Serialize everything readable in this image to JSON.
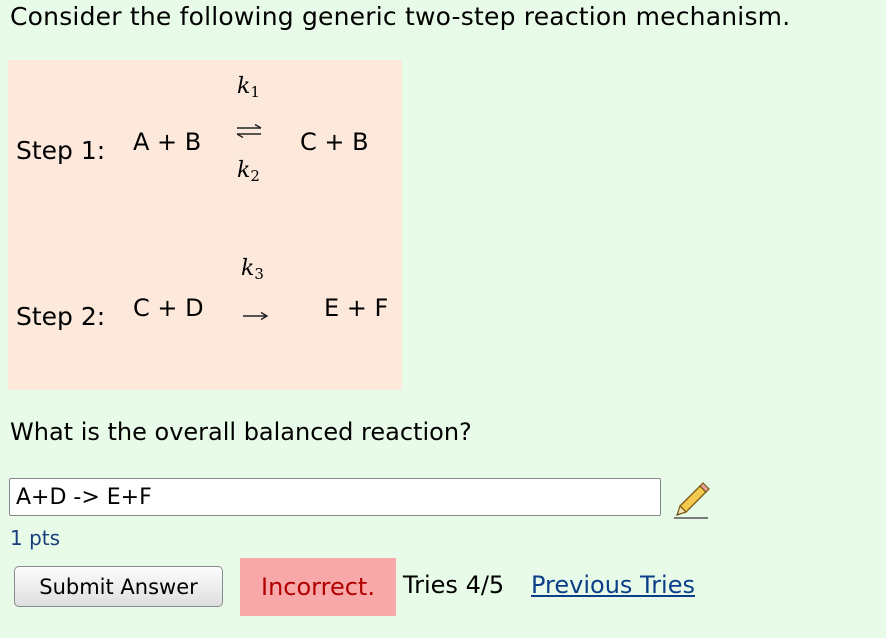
{
  "intro": "Consider the following generic two-step reaction mechanism.",
  "mechanism": {
    "step1": {
      "label": "Step 1:",
      "reactants": "A + B",
      "forward_k": "k",
      "forward_k_sub": "1",
      "reverse_k": "k",
      "reverse_k_sub": "2",
      "arrow_icon": "equilibrium-arrows-icon",
      "products": "C + B"
    },
    "step2": {
      "label": "Step 2:",
      "reactants": "C + D",
      "forward_k": "k",
      "forward_k_sub": "3",
      "arrow_icon": "right-arrow-icon",
      "products": "E + F"
    }
  },
  "question": "What is the overall balanced reaction?",
  "answer": {
    "value": "A+D -> E+F",
    "edit_icon": "pencil-icon"
  },
  "points": "1 pts",
  "submit_label": "Submit Answer",
  "status": {
    "result": "Incorrect.",
    "tries": "Tries 4/5",
    "previous_tries_link": "Previous Tries"
  },
  "colors": {
    "page_bg": "#e8fbe8",
    "mechanism_bg": "#fde9dc",
    "incorrect_bg": "#f8a8a8",
    "incorrect_text": "#b00000",
    "link": "#0c3f8a"
  }
}
